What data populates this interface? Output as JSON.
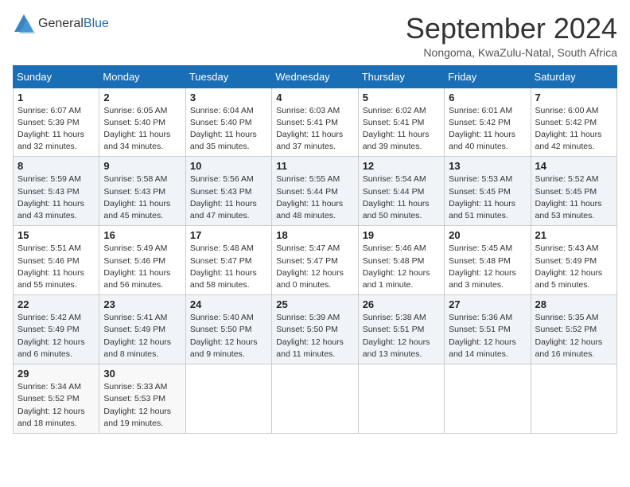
{
  "header": {
    "logo_general": "General",
    "logo_blue": "Blue",
    "month": "September 2024",
    "location": "Nongoma, KwaZulu-Natal, South Africa"
  },
  "days_of_week": [
    "Sunday",
    "Monday",
    "Tuesday",
    "Wednesday",
    "Thursday",
    "Friday",
    "Saturday"
  ],
  "weeks": [
    [
      {
        "day": "1",
        "info": "Sunrise: 6:07 AM\nSunset: 5:39 PM\nDaylight: 11 hours\nand 32 minutes."
      },
      {
        "day": "2",
        "info": "Sunrise: 6:05 AM\nSunset: 5:40 PM\nDaylight: 11 hours\nand 34 minutes."
      },
      {
        "day": "3",
        "info": "Sunrise: 6:04 AM\nSunset: 5:40 PM\nDaylight: 11 hours\nand 35 minutes."
      },
      {
        "day": "4",
        "info": "Sunrise: 6:03 AM\nSunset: 5:41 PM\nDaylight: 11 hours\nand 37 minutes."
      },
      {
        "day": "5",
        "info": "Sunrise: 6:02 AM\nSunset: 5:41 PM\nDaylight: 11 hours\nand 39 minutes."
      },
      {
        "day": "6",
        "info": "Sunrise: 6:01 AM\nSunset: 5:42 PM\nDaylight: 11 hours\nand 40 minutes."
      },
      {
        "day": "7",
        "info": "Sunrise: 6:00 AM\nSunset: 5:42 PM\nDaylight: 11 hours\nand 42 minutes."
      }
    ],
    [
      {
        "day": "8",
        "info": "Sunrise: 5:59 AM\nSunset: 5:43 PM\nDaylight: 11 hours\nand 43 minutes."
      },
      {
        "day": "9",
        "info": "Sunrise: 5:58 AM\nSunset: 5:43 PM\nDaylight: 11 hours\nand 45 minutes."
      },
      {
        "day": "10",
        "info": "Sunrise: 5:56 AM\nSunset: 5:43 PM\nDaylight: 11 hours\nand 47 minutes."
      },
      {
        "day": "11",
        "info": "Sunrise: 5:55 AM\nSunset: 5:44 PM\nDaylight: 11 hours\nand 48 minutes."
      },
      {
        "day": "12",
        "info": "Sunrise: 5:54 AM\nSunset: 5:44 PM\nDaylight: 11 hours\nand 50 minutes."
      },
      {
        "day": "13",
        "info": "Sunrise: 5:53 AM\nSunset: 5:45 PM\nDaylight: 11 hours\nand 51 minutes."
      },
      {
        "day": "14",
        "info": "Sunrise: 5:52 AM\nSunset: 5:45 PM\nDaylight: 11 hours\nand 53 minutes."
      }
    ],
    [
      {
        "day": "15",
        "info": "Sunrise: 5:51 AM\nSunset: 5:46 PM\nDaylight: 11 hours\nand 55 minutes."
      },
      {
        "day": "16",
        "info": "Sunrise: 5:49 AM\nSunset: 5:46 PM\nDaylight: 11 hours\nand 56 minutes."
      },
      {
        "day": "17",
        "info": "Sunrise: 5:48 AM\nSunset: 5:47 PM\nDaylight: 11 hours\nand 58 minutes."
      },
      {
        "day": "18",
        "info": "Sunrise: 5:47 AM\nSunset: 5:47 PM\nDaylight: 12 hours\nand 0 minutes."
      },
      {
        "day": "19",
        "info": "Sunrise: 5:46 AM\nSunset: 5:48 PM\nDaylight: 12 hours\nand 1 minute."
      },
      {
        "day": "20",
        "info": "Sunrise: 5:45 AM\nSunset: 5:48 PM\nDaylight: 12 hours\nand 3 minutes."
      },
      {
        "day": "21",
        "info": "Sunrise: 5:43 AM\nSunset: 5:49 PM\nDaylight: 12 hours\nand 5 minutes."
      }
    ],
    [
      {
        "day": "22",
        "info": "Sunrise: 5:42 AM\nSunset: 5:49 PM\nDaylight: 12 hours\nand 6 minutes."
      },
      {
        "day": "23",
        "info": "Sunrise: 5:41 AM\nSunset: 5:49 PM\nDaylight: 12 hours\nand 8 minutes."
      },
      {
        "day": "24",
        "info": "Sunrise: 5:40 AM\nSunset: 5:50 PM\nDaylight: 12 hours\nand 9 minutes."
      },
      {
        "day": "25",
        "info": "Sunrise: 5:39 AM\nSunset: 5:50 PM\nDaylight: 12 hours\nand 11 minutes."
      },
      {
        "day": "26",
        "info": "Sunrise: 5:38 AM\nSunset: 5:51 PM\nDaylight: 12 hours\nand 13 minutes."
      },
      {
        "day": "27",
        "info": "Sunrise: 5:36 AM\nSunset: 5:51 PM\nDaylight: 12 hours\nand 14 minutes."
      },
      {
        "day": "28",
        "info": "Sunrise: 5:35 AM\nSunset: 5:52 PM\nDaylight: 12 hours\nand 16 minutes."
      }
    ],
    [
      {
        "day": "29",
        "info": "Sunrise: 5:34 AM\nSunset: 5:52 PM\nDaylight: 12 hours\nand 18 minutes."
      },
      {
        "day": "30",
        "info": "Sunrise: 5:33 AM\nSunset: 5:53 PM\nDaylight: 12 hours\nand 19 minutes."
      },
      {
        "day": "",
        "info": ""
      },
      {
        "day": "",
        "info": ""
      },
      {
        "day": "",
        "info": ""
      },
      {
        "day": "",
        "info": ""
      },
      {
        "day": "",
        "info": ""
      }
    ]
  ]
}
